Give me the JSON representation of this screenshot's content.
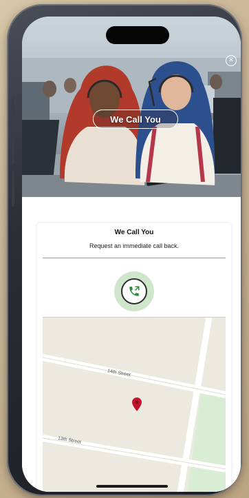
{
  "hero": {
    "cta_label": "We Call You",
    "close_icon": "close-circle-icon"
  },
  "card": {
    "title": "We Call You",
    "subtitle": "Request an immediate call back.",
    "call_button_icon": "phone-callback-icon"
  },
  "map": {
    "streets": [
      {
        "name": "14th Street"
      },
      {
        "name": "13th Street"
      }
    ],
    "marker_icon": "location-pin-icon"
  },
  "colors": {
    "call_ring": "#cfe6cc",
    "pin": "#c0142a",
    "map_bg": "#ece9e1",
    "park": "#d9ecd4"
  }
}
